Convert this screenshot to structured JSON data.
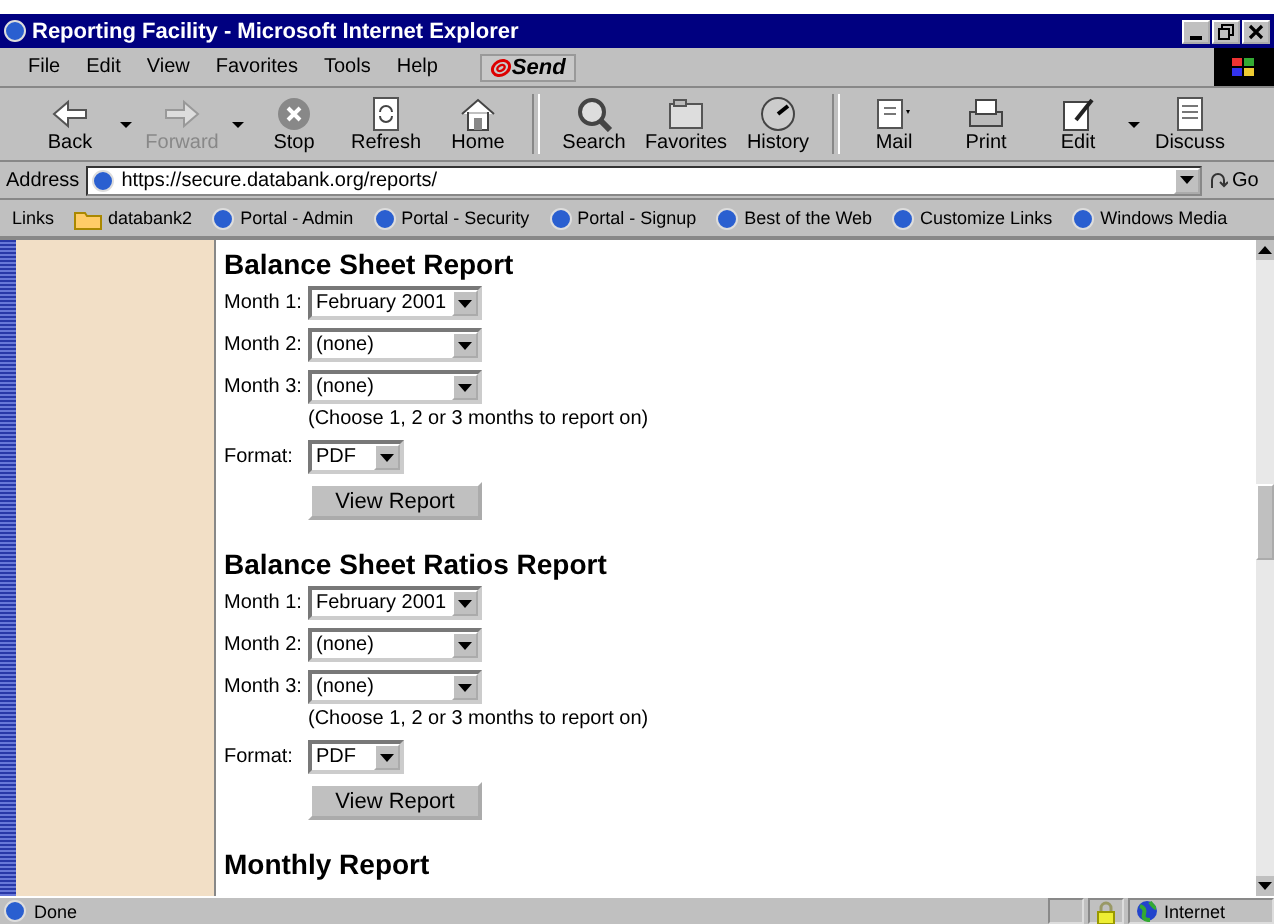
{
  "window": {
    "title": "Reporting Facility - Microsoft Internet Explorer"
  },
  "menu": [
    "File",
    "Edit",
    "View",
    "Favorites",
    "Tools",
    "Help"
  ],
  "send_button": "Send",
  "toolbar": [
    {
      "label": "Back",
      "kind": "back",
      "disabled": false,
      "dropdown": true
    },
    {
      "label": "Forward",
      "kind": "forward",
      "disabled": true,
      "dropdown": true
    },
    {
      "label": "Stop",
      "kind": "stop",
      "disabled": false,
      "dropdown": false
    },
    {
      "label": "Refresh",
      "kind": "refresh",
      "disabled": false,
      "dropdown": false
    },
    {
      "label": "Home",
      "kind": "home",
      "disabled": false,
      "dropdown": false
    },
    {
      "label": "Search",
      "kind": "search",
      "disabled": false,
      "dropdown": false
    },
    {
      "label": "Favorites",
      "kind": "favorites",
      "disabled": false,
      "dropdown": false
    },
    {
      "label": "History",
      "kind": "history",
      "disabled": false,
      "dropdown": false
    },
    {
      "label": "Mail",
      "kind": "mail",
      "disabled": false,
      "dropdown": false
    },
    {
      "label": "Print",
      "kind": "print",
      "disabled": false,
      "dropdown": false
    },
    {
      "label": "Edit",
      "kind": "edit",
      "disabled": false,
      "dropdown": true
    },
    {
      "label": "Discuss",
      "kind": "discuss",
      "disabled": false,
      "dropdown": false
    }
  ],
  "address": {
    "label": "Address",
    "value": "https://secure.databank.org/reports/",
    "go": "Go"
  },
  "links": {
    "label": "Links",
    "items": [
      {
        "label": "databank2",
        "kind": "folder"
      },
      {
        "label": "Portal - Admin",
        "kind": "page"
      },
      {
        "label": "Portal - Security",
        "kind": "page"
      },
      {
        "label": "Portal - Signup",
        "kind": "page"
      },
      {
        "label": "Best of the Web",
        "kind": "page"
      },
      {
        "label": "Customize Links",
        "kind": "page"
      },
      {
        "label": "Windows Media",
        "kind": "page"
      }
    ]
  },
  "reports": [
    {
      "title": "Balance Sheet Report",
      "fields": [
        {
          "label": "Month 1:",
          "value": "February 2001"
        },
        {
          "label": "Month 2:",
          "value": "(none)"
        },
        {
          "label": "Month 3:",
          "value": "(none)"
        }
      ],
      "hint": "(Choose 1, 2 or 3 months to report on)",
      "format": {
        "label": "Format:",
        "value": "PDF"
      },
      "button": "View Report"
    },
    {
      "title": "Balance Sheet Ratios Report",
      "fields": [
        {
          "label": "Month 1:",
          "value": "February 2001"
        },
        {
          "label": "Month 2:",
          "value": "(none)"
        },
        {
          "label": "Month 3:",
          "value": "(none)"
        }
      ],
      "hint": "(Choose 1, 2 or 3 months to report on)",
      "format": {
        "label": "Format:",
        "value": "PDF"
      },
      "button": "View Report"
    },
    {
      "title": "Monthly Report"
    }
  ],
  "status_bar": {
    "text": "Done",
    "zone": "Internet",
    "secure": true
  }
}
